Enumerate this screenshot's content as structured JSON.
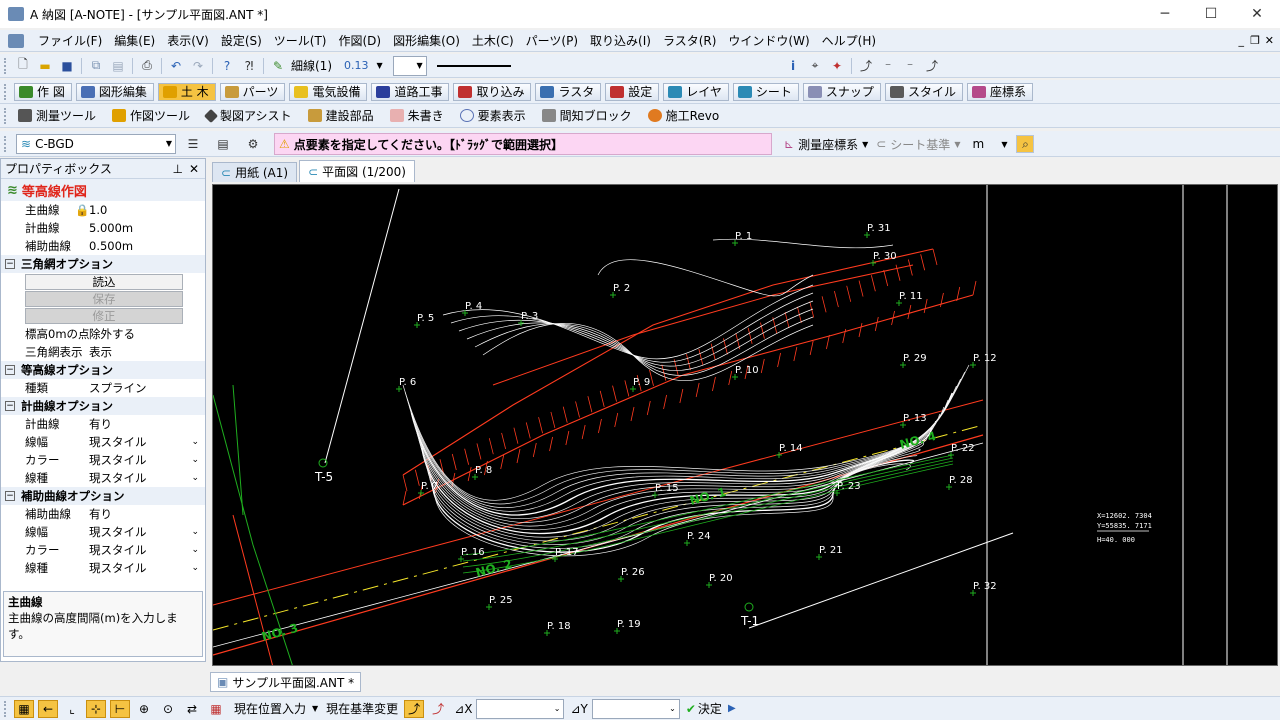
{
  "titlebar": {
    "title": "A 納図 [A-NOTE] - [サンプル平面図.ANT *]",
    "minimize": "─",
    "maximize": "☐",
    "close": "✕"
  },
  "menu": [
    "ファイル(F)",
    "編集(E)",
    "表示(V)",
    "設定(S)",
    "ツール(T)",
    "作図(D)",
    "図形編集(O)",
    "土木(C)",
    "パーツ(P)",
    "取り込み(I)",
    "ラスタ(R)",
    "ウインドウ(W)",
    "ヘルプ(H)"
  ],
  "toolbar1": {
    "linetype": "細線(1)",
    "linewidth": "0.13"
  },
  "tabs_row": [
    "作 図",
    "図形編集",
    "土 木",
    "パーツ",
    "電気設備",
    "道路工事",
    "取り込み",
    "ラスタ",
    "設定",
    "レイヤ",
    "シート",
    "スナップ",
    "スタイル",
    "座標系"
  ],
  "tools_row": [
    "測量ツール",
    "作図ツール",
    "製図アシスト",
    "建設部品",
    "朱書き",
    "要素表示",
    "間知ブロック",
    "施工Revo"
  ],
  "layer_combo": "C-BGD",
  "prompt": "点要素を指定してください。【ﾄﾞﾗｯｸﾞで範囲選択】",
  "coord_system": "測量座標系",
  "sheet_base": "シート基準",
  "unit": "m",
  "propbox": {
    "header": "プロパティボックス",
    "title": "等高線作図",
    "rows_top": [
      {
        "k": "主曲線",
        "v": "1.0"
      },
      {
        "k": "計曲線",
        "v": "5.000m"
      },
      {
        "k": "補助曲線",
        "v": "0.500m"
      }
    ],
    "sec1": "三角網オプション",
    "btn_read": "読込",
    "btn_save": "保存",
    "btn_fix": "修正",
    "rows_tri": [
      {
        "k": "標高0mの点",
        "v": "除外する"
      },
      {
        "k": "三角網表示",
        "v": "表示"
      }
    ],
    "sec2": "等高線オプション",
    "rows_contour": [
      {
        "k": "種類",
        "v": "スプライン"
      }
    ],
    "sec3": "計曲線オプション",
    "rows_keiku": [
      {
        "k": "計曲線",
        "v": "有り"
      },
      {
        "k": "線幅",
        "v": "現スタイル"
      },
      {
        "k": "カラー",
        "v": "現スタイル"
      },
      {
        "k": "線種",
        "v": "現スタイル"
      }
    ],
    "sec4": "補助曲線オプション",
    "rows_hojo": [
      {
        "k": "補助曲線",
        "v": "有り"
      },
      {
        "k": "線幅",
        "v": "現スタイル"
      },
      {
        "k": "カラー",
        "v": "現スタイル"
      },
      {
        "k": "線種",
        "v": "現スタイル"
      }
    ],
    "desc_title": "主曲線",
    "desc_text": "主曲線の高度間隔(m)を入力します。"
  },
  "doc_tabs": [
    "用紙 (A1)",
    "平面図 (1/200)"
  ],
  "doc_file_tab": "サンプル平面図.ANT *",
  "points": [
    "P. 1",
    "P. 2",
    "P. 3",
    "P. 4",
    "P. 5",
    "P. 6",
    "P. 7",
    "P. 8",
    "P. 9",
    "P. 10",
    "P. 11",
    "P. 12",
    "P. 13",
    "P. 14",
    "P. 15",
    "P. 16",
    "P. 17",
    "P. 18",
    "P. 19",
    "P. 20",
    "P. 21",
    "P. 22",
    "P. 23",
    "P. 24",
    "P. 25",
    "P. 26",
    "P. 28",
    "P. 29",
    "P. 30",
    "P. 31",
    "P. 32",
    "T-1",
    "T-5"
  ],
  "road_labels": [
    "NO. 1",
    "NO. 2",
    "NO. 3",
    "NO. 4"
  ],
  "coord_readout": [
    "X=12602. 7304",
    "Y=55835. 7171",
    "H=40. 000"
  ],
  "statusbar": {
    "current_pos": "現在位置入力",
    "base_change": "現在基準変更",
    "dx": "⊿X",
    "dy": "⊿Y",
    "ok": "決定"
  },
  "colors": {
    "contour": "#ffffff",
    "slope": "#ff3b1f",
    "green": "#1fae1f",
    "yellow": "#f5e62a",
    "prompt_bg": "#fcd6f3"
  }
}
